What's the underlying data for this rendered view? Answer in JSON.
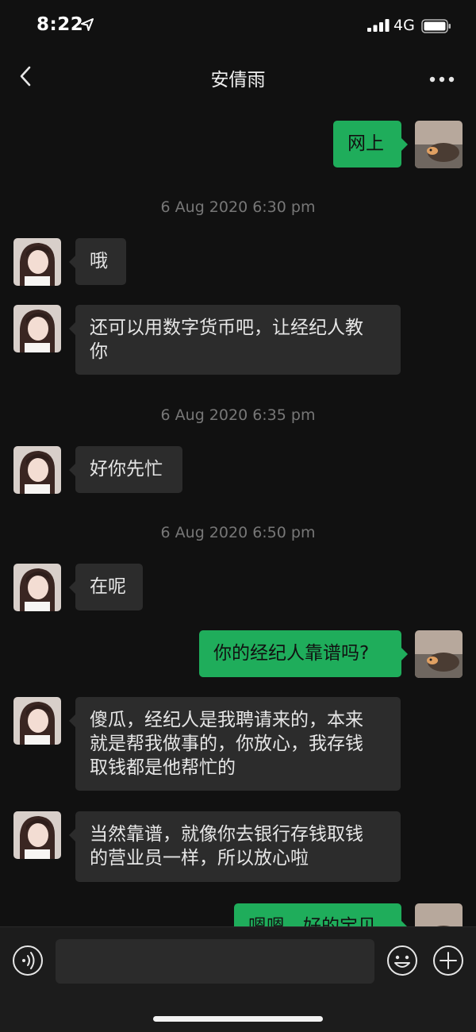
{
  "status_bar": {
    "time": "8:22",
    "network": "4G",
    "location_icon": "location-arrow-icon",
    "signal_icon": "cellular-signal-icon",
    "battery_icon": "battery-full-icon"
  },
  "header": {
    "title": "安倩雨",
    "back_icon": "chevron-left-icon",
    "more_icon": "more-dots-icon"
  },
  "messages": [
    {
      "type": "out",
      "text": "网上"
    },
    {
      "type": "time",
      "text": "6 Aug 2020 6:30 pm"
    },
    {
      "type": "in",
      "text": "哦"
    },
    {
      "type": "in",
      "text": "还可以用数字货币吧，让经纪人教\n你"
    },
    {
      "type": "time",
      "text": "6 Aug 2020 6:35 pm"
    },
    {
      "type": "in",
      "text": "好你先忙"
    },
    {
      "type": "time",
      "text": "6 Aug 2020 6:50 pm"
    },
    {
      "type": "in",
      "text": "在呢"
    },
    {
      "type": "out",
      "text": "你的经纪人靠谱吗?"
    },
    {
      "type": "in",
      "text": "傻瓜，经纪人是我聘请来的，本来\n就是帮我做事的，你放心，我存钱\n取钱都是他帮忙的"
    },
    {
      "type": "in",
      "text": "当然靠谱，就像你去银行存钱取钱\n的营业员一样，所以放心啦"
    },
    {
      "type": "out",
      "text": "嗯嗯，好的宝贝"
    }
  ],
  "input_bar": {
    "voice_icon": "voice-input-icon",
    "input_value": "",
    "emoji_icon": "emoji-icon",
    "add_icon": "plus-circle-icon"
  },
  "colors": {
    "background": "#111111",
    "incoming_bubble": "#2c2c2c",
    "outgoing_bubble": "#1fad5b",
    "timestamp_text": "#777777"
  }
}
